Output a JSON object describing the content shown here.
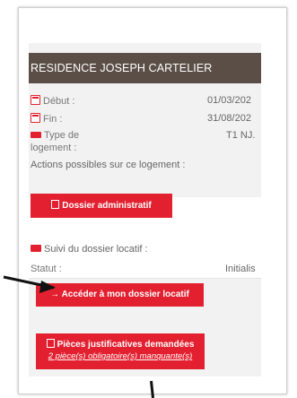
{
  "header": {
    "title": "RESIDENCE JOSEPH CARTELIER"
  },
  "details": {
    "debut_label": "Début :",
    "debut_value": "01/03/202",
    "fin_label": "Fin :",
    "fin_value": "31/08/202",
    "type_label_1": "Type de",
    "type_label_2": "logement :",
    "type_value": "T1 NJ."
  },
  "actions": {
    "title": "Actions possibles sur ce logement :",
    "dossier_admin_label": "Dossier administratif"
  },
  "suivi": {
    "title": "Suivi du dossier locatif :",
    "statut_label": "Statut :",
    "statut_value": "Initialis",
    "acceder_label": "→ Accéder à mon dossier locatif"
  },
  "pieces": {
    "label": "Pièces justificatives demandées",
    "sub": "2 pièce(s) obligatoire(s) manquante(s)"
  },
  "colors": {
    "accent": "#e3202f",
    "header_bg": "#5a4e46"
  }
}
